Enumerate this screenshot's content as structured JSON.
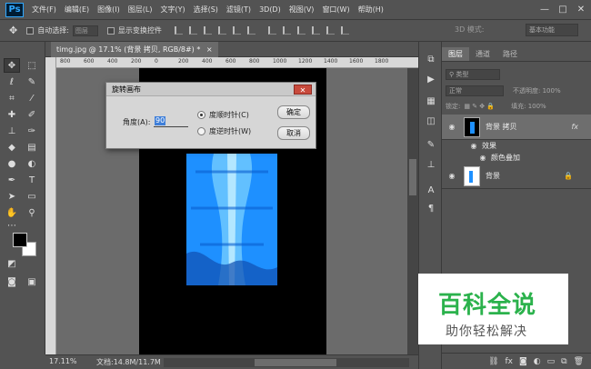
{
  "app": {
    "logo": "Ps"
  },
  "menu": [
    "文件(F)",
    "编辑(E)",
    "图像(I)",
    "图层(L)",
    "文字(Y)",
    "选择(S)",
    "滤镜(T)",
    "3D(D)",
    "视图(V)",
    "窗口(W)",
    "帮助(H)"
  ],
  "window_controls": {
    "minimize": "—",
    "restore": "□",
    "close": "✕"
  },
  "options": {
    "auto_select_label": "自动选择:",
    "auto_select_value": "图层",
    "transform_label": "显示变换控件",
    "mode_3d": "3D 模式:",
    "workspace": "基本功能"
  },
  "document": {
    "tab_title": "timg.jpg @ 17.1% (背景 拷贝, RGB/8#) *",
    "tab_close": "×",
    "ruler_ticks": [
      "800",
      "600",
      "400",
      "200",
      "0",
      "200",
      "400",
      "600",
      "800",
      "1000",
      "1200",
      "1400",
      "1600",
      "1800"
    ]
  },
  "status": {
    "zoom": "17.11%",
    "doc_info": "文档:14.8M/11.7M"
  },
  "dialog": {
    "title": "旋转画布",
    "close": "✕",
    "angle_label": "角度(A):",
    "angle_value": "90",
    "clockwise_label": "度顺时针(C)",
    "counterclockwise_label": "度逆时针(W)",
    "clockwise_selected": true,
    "ok_button": "确定",
    "cancel_button": "取消"
  },
  "panel": {
    "tabs": [
      "图层",
      "通道",
      "路径"
    ],
    "filter_label": "类型",
    "blend_mode": "正常",
    "opacity_label": "不透明度: 100%",
    "lock_label": "锁定:",
    "fill_label": "填充: 100%",
    "layers": [
      {
        "name": "背景 拷贝",
        "selected": true,
        "fx": "fx"
      },
      {
        "name": "背景",
        "selected": false
      }
    ],
    "effects_label": "效果",
    "effect_item": "颜色叠加"
  },
  "watermark": {
    "title": "百科全说",
    "subtitle": "助你轻松解决"
  },
  "colors": {
    "accent_blue": "#1e90ff",
    "dialog_bg": "#d6d6d6",
    "close_red": "#c84a3c",
    "watermark_green": "#2bb24c"
  }
}
